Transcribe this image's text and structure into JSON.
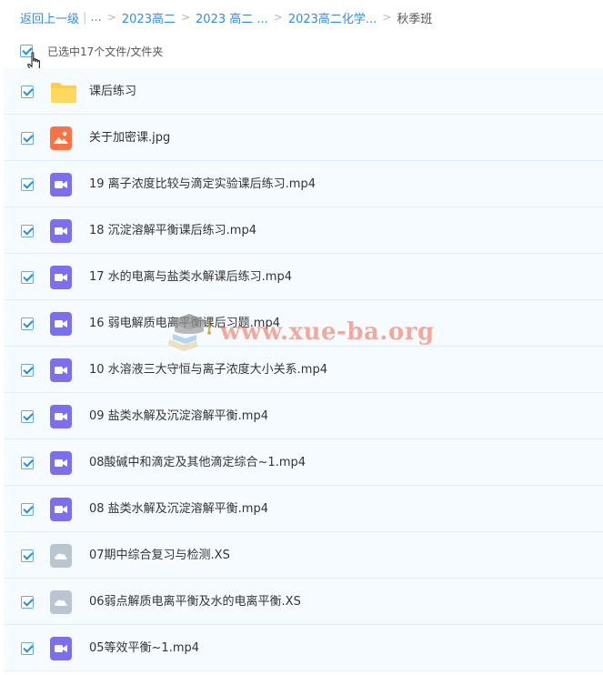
{
  "breadcrumb": {
    "back": "返回上一级",
    "bar": "|",
    "ellipsis": "...",
    "sep": ">",
    "items": [
      "2023高二",
      "2023 高二 ...",
      "2023高二化学..."
    ],
    "current": "秋季班"
  },
  "selection": {
    "label": "已选中17个文件/文件夹",
    "checked": true
  },
  "files": [
    {
      "name": "课后练习",
      "icon": "folder-icon",
      "checked": true
    },
    {
      "name": "关于加密课.jpg",
      "icon": "image-file-icon",
      "checked": true
    },
    {
      "name": "19 离子浓度比较与滴定实验课后练习.mp4",
      "icon": "video-file-icon",
      "checked": true
    },
    {
      "name": "18 沉淀溶解平衡课后练习.mp4",
      "icon": "video-file-icon",
      "checked": true
    },
    {
      "name": "17 水的电离与盐类水解课后练习.mp4",
      "icon": "video-file-icon",
      "checked": true
    },
    {
      "name": "16 弱电解质电离平衡课后习题.mp4",
      "icon": "video-file-icon",
      "checked": true
    },
    {
      "name": "10 水溶液三大守恒与离子浓度大小关系.mp4",
      "icon": "video-file-icon",
      "checked": true
    },
    {
      "name": "09 盐类水解及沉淀溶解平衡.mp4",
      "icon": "video-file-icon",
      "checked": true
    },
    {
      "name": "08酸碱中和滴定及其他滴定综合~1.mp4",
      "icon": "video-file-icon",
      "checked": true
    },
    {
      "name": "08 盐类水解及沉淀溶解平衡.mp4",
      "icon": "video-file-icon",
      "checked": true
    },
    {
      "name": "07期中综合复习与检测.XS",
      "icon": "cloud-file-icon",
      "checked": true
    },
    {
      "name": "06弱点解质电离平衡及水的电离平衡.XS",
      "icon": "cloud-file-icon",
      "checked": true
    },
    {
      "name": "05等效平衡~1.mp4",
      "icon": "video-file-icon",
      "checked": true
    }
  ],
  "watermark": "www.xue-ba.org",
  "colors": {
    "link": "#2d8cf0",
    "row_bg": "#f6fbff",
    "folder": "#ffcd4a",
    "image_file": "#ff7043",
    "video_file": "#7b6ff0",
    "cloud_file": "#b9c6d2"
  }
}
